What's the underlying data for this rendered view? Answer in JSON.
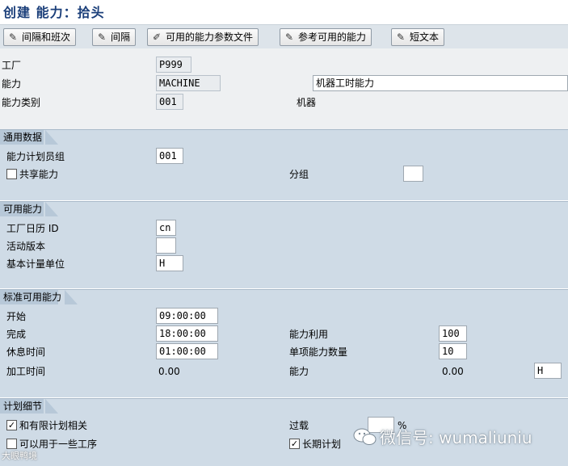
{
  "window": {
    "title": "创建 能力：拾头"
  },
  "toolbar": {
    "btn1": "间隔和班次",
    "btn2": "间隔",
    "btn3": "可用的能力参数文件",
    "btn4": "参考可用的能力",
    "btn5": "短文本"
  },
  "header": {
    "plant_label": "工厂",
    "plant_value": "P999",
    "capacity_label": "能力",
    "capacity_value": "MACHINE",
    "capacity_desc": "机器工时能力",
    "category_label": "能力类别",
    "category_value": "001",
    "category_desc": "机器"
  },
  "general": {
    "title": "通用数据",
    "planner_group_label": "能力计划员组",
    "planner_group_value": "001",
    "shared_label": "共享能力",
    "grouping_label": "分组",
    "grouping_value": ""
  },
  "available": {
    "title": "可用能力",
    "calendar_label": "工厂日历 ID",
    "calendar_value": "cn",
    "version_label": "活动版本",
    "version_value": "",
    "uom_label": "基本计量单位",
    "uom_value": "H"
  },
  "standard": {
    "title": "标准可用能力",
    "start_label": "开始",
    "start_value": "09:00:00",
    "finish_label": "完成",
    "finish_value": "18:00:00",
    "break_label": "休息时间",
    "break_value": "01:00:00",
    "op_time_label": "加工时间",
    "op_time_value": "0.00",
    "utilization_label": "能力利用",
    "utilization_value": "100",
    "indiv_count_label": "单项能力数量",
    "indiv_count_value": "10",
    "capacity_label": "能力",
    "capacity_value": "0.00",
    "capacity_unit": "H"
  },
  "planning": {
    "title": "计划细节",
    "finite_label": "和有限计划相关",
    "several_ops_label": "可以用于一些工序",
    "overload_label": "过载",
    "overload_value": "",
    "overload_unit": "%",
    "longterm_label": "长期计划"
  },
  "watermark": {
    "text": "微信号: wumaliuniu",
    "corner": "大眼鸭境"
  },
  "colors": {
    "toolbar": "#dde4ea",
    "section": "#cfdbe6",
    "section_tab": "#b7c8d8",
    "title": "#1b3f7a"
  }
}
